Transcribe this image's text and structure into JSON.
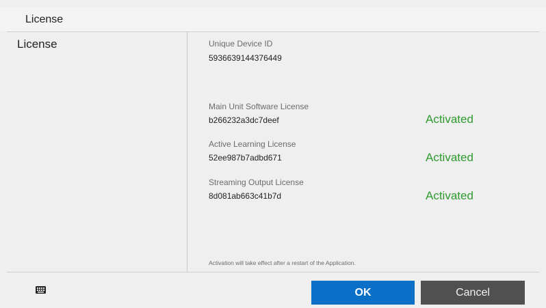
{
  "window": {
    "title": "License"
  },
  "sidebar": {
    "items": [
      {
        "label": "License"
      }
    ]
  },
  "device": {
    "label": "Unique Device ID",
    "value": "5936639144376449"
  },
  "licenses": [
    {
      "label": "Main Unit Software License",
      "key": "b266232a3dc7deef",
      "status": "Activated"
    },
    {
      "label": "Active Learning License",
      "key": "52ee987b7adbd671",
      "status": "Activated"
    },
    {
      "label": "Streaming Output License",
      "key": "8d081ab663c41b7d",
      "status": "Activated"
    }
  ],
  "note": "Activation will take effect after a restart of the Application.",
  "footer": {
    "keyboard_icon": "keyboard-icon",
    "ok_label": "OK",
    "cancel_label": "Cancel"
  },
  "colors": {
    "status_active": "#2e9b2e",
    "ok_button": "#0a6fc6",
    "cancel_button": "#505050"
  }
}
